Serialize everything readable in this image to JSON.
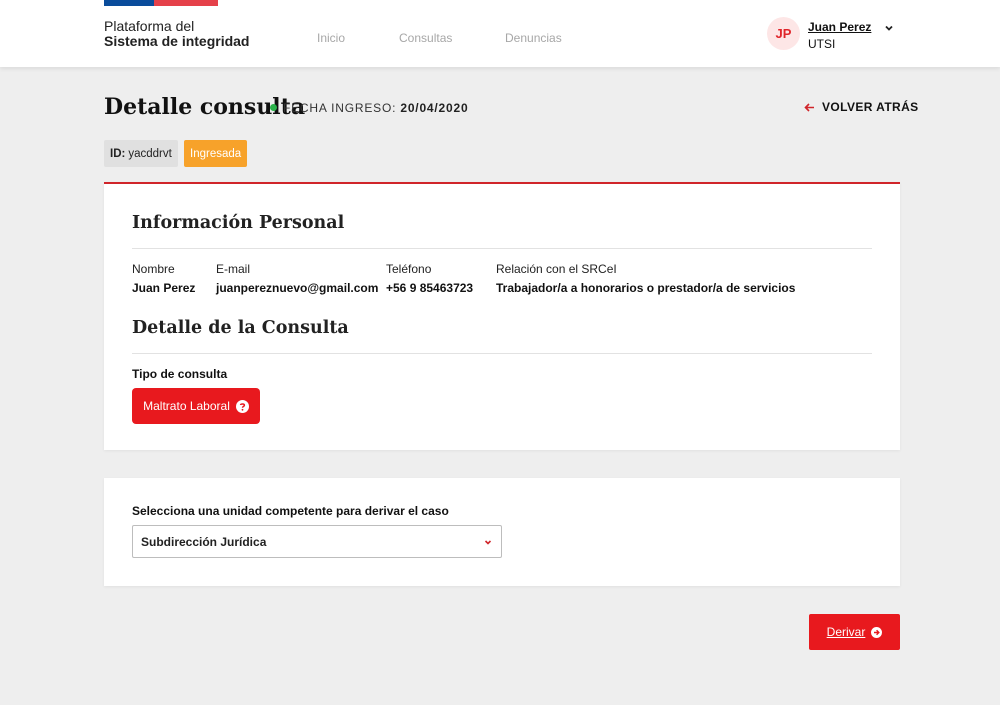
{
  "header": {
    "brand_line1": "Plataforma del",
    "brand_line2": "Sistema de integridad",
    "nav": [
      "Inicio",
      "Consultas",
      "Denuncias"
    ],
    "user": {
      "initials": "JP",
      "name": "Juan Perez",
      "unit": "UTSI"
    }
  },
  "page": {
    "title": "Detalle consulta",
    "fecha_label": "FECHA INGRESO:",
    "fecha_value": "20/04/2020",
    "back_label": "VOLVER ATRÁS",
    "id_label": "ID:",
    "id_value": "yacddrvt",
    "status": "Ingresada"
  },
  "personal": {
    "title": "Información Personal",
    "fields": [
      {
        "label": "Nombre",
        "value": "Juan Perez"
      },
      {
        "label": "E-mail",
        "value": "juanpereznuevo@gmail.com"
      },
      {
        "label": "Teléfono",
        "value": "+56 9 85463723"
      },
      {
        "label": "Relación con el SRCeI",
        "value": "Trabajador/a a honorarios o prestador/a de servicios"
      }
    ]
  },
  "consulta": {
    "title": "Detalle de la Consulta",
    "tipo_label": "Tipo de consulta",
    "tipo_value": "Maltrato Laboral"
  },
  "derivacion": {
    "label": "Selecciona una unidad competente para derivar el caso",
    "selected": "Subdirección Jurídica",
    "button": "Derivar"
  },
  "colors": {
    "accent_red": "#e8191e",
    "status_orange": "#f7a22a",
    "date_dot_green": "#2bb34b"
  }
}
